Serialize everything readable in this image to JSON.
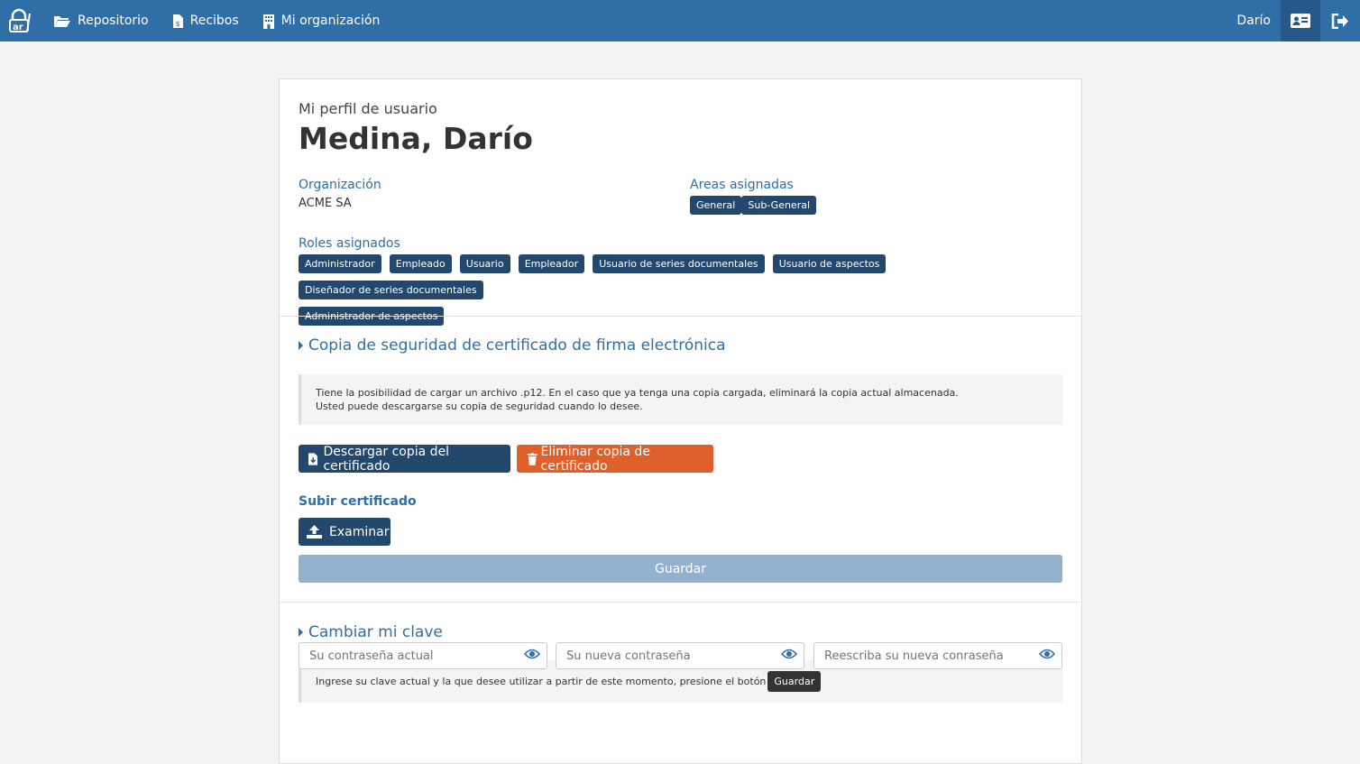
{
  "navbar": {
    "logo_icon": "ar-logo-icon",
    "items": [
      {
        "label": "Repositorio",
        "icon": "folder-open-icon"
      },
      {
        "label": "Recibos",
        "icon": "file-dollar-icon"
      },
      {
        "label": "Mi organización",
        "icon": "building-icon"
      }
    ],
    "user_name": "Darío",
    "profile_icon": "id-card-icon",
    "logout_icon": "sign-out-icon"
  },
  "profile": {
    "subtitle": "Mi perfil de usuario",
    "name": "Medina, Darío",
    "organization_label": "Organización",
    "organization_value": "ACME SA",
    "areas_label": "Areas asignadas",
    "areas": [
      "General",
      "Sub-General"
    ],
    "roles_label": "Roles asignados",
    "roles": [
      "Administrador",
      "Empleado",
      "Usuario",
      "Empleador",
      "Usuario de series documentales",
      "Usuario de aspectos",
      "Diseñador de series documentales",
      "Administrador de aspectos"
    ]
  },
  "certificate": {
    "title": "Copia de seguridad de certificado de firma electrónica",
    "info_line1": "Tiene la posibilidad de cargar un archivo .p12. En el caso que ya tenga una copia cargada, eliminará la copia actual almacenada.",
    "info_line2": "Usted puede descargarse su copia de seguridad cuando lo desee.",
    "download_label": "Descargar copia del certificado",
    "delete_label": "Eliminar copia de certificado",
    "upload_label": "Subir certificado",
    "browse_label": "Examinar",
    "save_label": "Guardar"
  },
  "password": {
    "title": "Cambiar mi clave",
    "info_text": "Ingrese su clave actual y la que desee utilizar a partir de este momento, presione el botón",
    "info_badge": "Guardar",
    "current_placeholder": "Su contraseña actual",
    "new_placeholder": "Su nueva contraseña",
    "repeat_placeholder": "Reescriba su nueva conraseña"
  },
  "colors": {
    "navbar": "#2f6ea6",
    "primary": "#23486e",
    "danger": "#e0602c",
    "disabled": "#92b1cf"
  }
}
